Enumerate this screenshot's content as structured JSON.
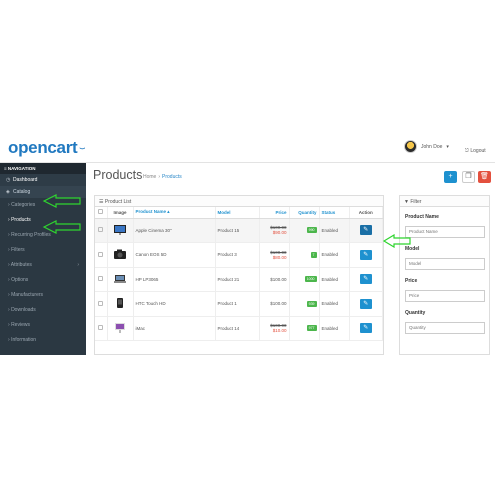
{
  "header": {
    "logo_text": "opencart",
    "logo_mark": ".̄̄",
    "user_name": "John Doe",
    "user_caret": "▾",
    "logout": "Logout"
  },
  "sidebar": {
    "nav_heading": "NAVIGATION",
    "items": [
      {
        "label": "Dashboard",
        "icon": "dashboard-icon"
      },
      {
        "label": "Catalog",
        "icon": "tag-icon"
      },
      {
        "label": "Categories"
      },
      {
        "label": "Products"
      },
      {
        "label": "Recurring Profiles"
      },
      {
        "label": "Filters"
      },
      {
        "label": "Attributes",
        "has_caret": true
      },
      {
        "label": "Options"
      },
      {
        "label": "Manufacturers"
      },
      {
        "label": "Downloads"
      },
      {
        "label": "Reviews"
      },
      {
        "label": "Information"
      }
    ]
  },
  "page": {
    "title": "Products",
    "breadcrumb": [
      "Home",
      "Products"
    ]
  },
  "product_list": {
    "heading": "Product List",
    "columns": [
      "",
      "Image",
      "Product Name ▴",
      "Model",
      "Price",
      "Quantity",
      "Status",
      "Action"
    ],
    "rows": [
      {
        "name": "Apple Cinema 30\"",
        "model": "Product 15",
        "old_price": "$100.00",
        "price": "$90.00",
        "qty": "990",
        "status": "Enabled",
        "image": "monitor-icon"
      },
      {
        "name": "Canon EOS 5D",
        "model": "Product 3",
        "old_price": "$100.00",
        "price": "$80.00",
        "qty": "7",
        "status": "Enabled",
        "image": "camera-icon"
      },
      {
        "name": "HP LP3065",
        "model": "Product 21",
        "old_price": "",
        "price": "$100.00",
        "qty": "1000",
        "status": "Enabled",
        "image": "laptop-icon"
      },
      {
        "name": "HTC Touch HD",
        "model": "Product 1",
        "old_price": "",
        "price": "$100.00",
        "qty": "939",
        "status": "Enabled",
        "image": "phone-icon"
      },
      {
        "name": "iMac",
        "model": "Product 14",
        "old_price": "$100.00",
        "price": "$10.00",
        "qty": "977",
        "status": "Enabled",
        "image": "imac-icon"
      }
    ]
  },
  "filter": {
    "heading": "Filter",
    "fields": [
      {
        "label": "Product Name",
        "placeholder": "Product Name"
      },
      {
        "label": "Model",
        "placeholder": "Model"
      },
      {
        "label": "Price",
        "placeholder": "Price"
      },
      {
        "label": "Quantity",
        "placeholder": "Quantity"
      }
    ]
  },
  "colors": {
    "accent": "#1e91cf",
    "sidebar": "#2b3842",
    "danger": "#e3503e",
    "success": "#4cb64c",
    "annotation_arrow": "#2fd42f"
  }
}
